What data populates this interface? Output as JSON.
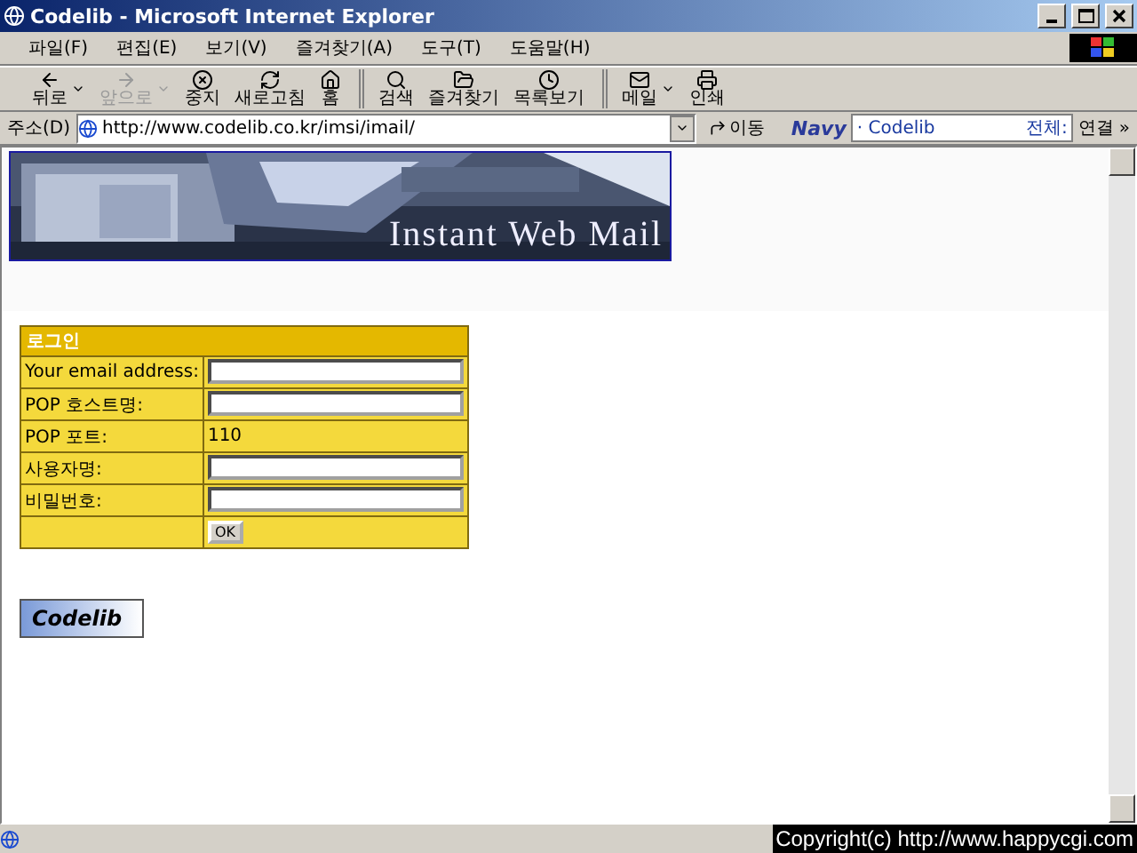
{
  "window": {
    "title": "Codelib - Microsoft Internet Explorer"
  },
  "menu": [
    "파일(F)",
    "편집(E)",
    "보기(V)",
    "즐겨찾기(A)",
    "도구(T)",
    "도움말(H)"
  ],
  "toolbar": [
    {
      "label": "뒤로",
      "disabled": false,
      "dropdown": true
    },
    {
      "label": "앞으로",
      "disabled": true,
      "dropdown": true
    },
    {
      "label": "중지",
      "disabled": false,
      "dropdown": false
    },
    {
      "label": "새로고침",
      "disabled": false,
      "dropdown": false
    },
    {
      "label": "홈",
      "disabled": false,
      "dropdown": false
    },
    {
      "label": "검색",
      "disabled": false,
      "dropdown": false,
      "group_start": true
    },
    {
      "label": "즐겨찾기",
      "disabled": false,
      "dropdown": false
    },
    {
      "label": "목록보기",
      "disabled": false,
      "dropdown": false
    },
    {
      "label": "메일",
      "disabled": false,
      "dropdown": true,
      "group_start": true
    },
    {
      "label": "인쇄",
      "disabled": false,
      "dropdown": false
    }
  ],
  "address": {
    "label": "주소(D)",
    "url": "http://www.codelib.co.kr/imsi/imail/",
    "go": "이동"
  },
  "links_bar": {
    "brand": "Navy",
    "search_value": "· Codelib",
    "scope": "전체:",
    "links": "연결",
    "more": "»"
  },
  "page": {
    "banner_title": "Instant Web Mail",
    "form": {
      "header": "로그인",
      "rows": [
        {
          "label": "Your email address:",
          "kind": "input"
        },
        {
          "label": "POP 호스트명:",
          "kind": "input"
        },
        {
          "label": "POP 포트:",
          "kind": "text",
          "value": "110"
        },
        {
          "label": "사용자명:",
          "kind": "input"
        },
        {
          "label": "비밀번호:",
          "kind": "input"
        }
      ],
      "submit": "OK"
    },
    "logo": "Codelib"
  },
  "status_bar": {
    "copyright": "Copyright(c) http://www.happycgi.com"
  }
}
